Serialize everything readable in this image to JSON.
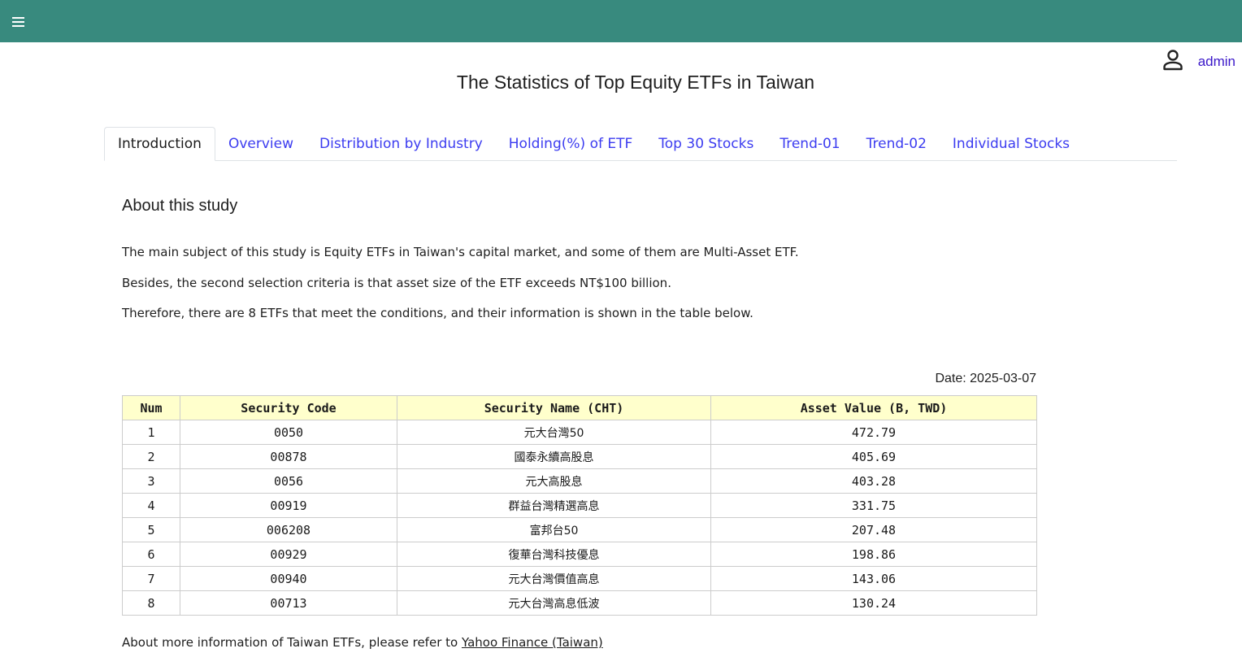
{
  "header": {
    "menu_icon": "hamburger-menu-icon",
    "user_icon": "person-icon",
    "user_name": "admin"
  },
  "page": {
    "title": "The Statistics of Top Equity ETFs in Taiwan"
  },
  "tabs": [
    {
      "label": "Introduction",
      "active": true
    },
    {
      "label": "Overview",
      "active": false
    },
    {
      "label": "Distribution by Industry",
      "active": false
    },
    {
      "label": "Holding(%) of ETF",
      "active": false
    },
    {
      "label": "Top 30 Stocks",
      "active": false
    },
    {
      "label": "Trend-01",
      "active": false
    },
    {
      "label": "Trend-02",
      "active": false
    },
    {
      "label": "Individual Stocks",
      "active": false
    }
  ],
  "intro": {
    "heading": "About this study",
    "paragraphs": [
      "The main subject of this study is Equity ETFs in Taiwan's capital market, and some of them are Multi-Asset ETF.",
      "Besides, the second selection criteria is that asset size of the ETF exceeds NT$100 billion.",
      "Therefore, there are 8 ETFs that meet the conditions, and their information is shown in the table below."
    ],
    "date_label": "Date: 2025-03-07"
  },
  "table": {
    "columns": [
      "Num",
      "Security Code",
      "Security Name (CHT)",
      "Asset Value (B, TWD)"
    ],
    "rows": [
      [
        "1",
        "0050",
        "元大台灣50",
        "472.79"
      ],
      [
        "2",
        "00878",
        "國泰永續高股息",
        "405.69"
      ],
      [
        "3",
        "0056",
        "元大高股息",
        "403.28"
      ],
      [
        "4",
        "00919",
        "群益台灣精選高息",
        "331.75"
      ],
      [
        "5",
        "006208",
        "富邦台50",
        "207.48"
      ],
      [
        "6",
        "00929",
        "復華台灣科技優息",
        "198.86"
      ],
      [
        "7",
        "00940",
        "元大台灣價值高息",
        "143.06"
      ],
      [
        "8",
        "00713",
        "元大台灣高息低波",
        "130.24"
      ]
    ],
    "header_bg": "#ffffcc"
  },
  "footer": {
    "text": "About more information of Taiwan ETFs, please refer to ",
    "link_label": "Yahoo Finance (Taiwan)"
  },
  "colors": {
    "topbar": "#388a7e",
    "link": "#3c3cf0",
    "user_link": "#3a17c9"
  }
}
